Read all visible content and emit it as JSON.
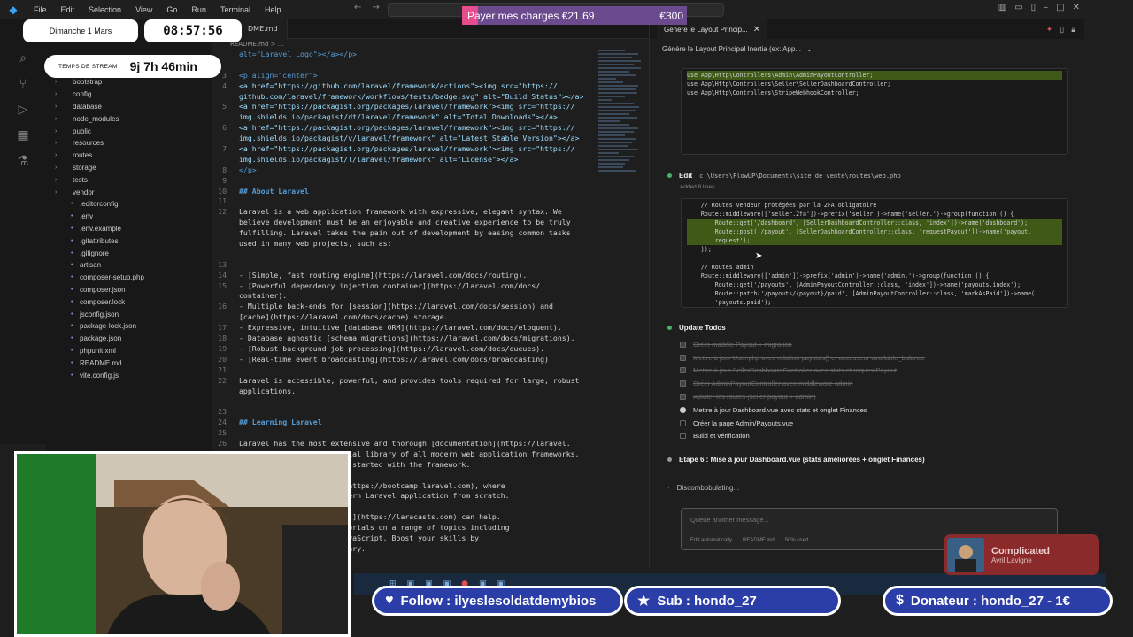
{
  "titlebar": {
    "menus": [
      "File",
      "Edit",
      "Selection",
      "View",
      "Go",
      "Run",
      "Terminal",
      "Help"
    ]
  },
  "sidebar": {
    "items": [
      {
        "name": "bootstrap",
        "type": "folder"
      },
      {
        "name": "config",
        "type": "folder"
      },
      {
        "name": "database",
        "type": "folder"
      },
      {
        "name": "node_modules",
        "type": "folder"
      },
      {
        "name": "public",
        "type": "folder"
      },
      {
        "name": "resources",
        "type": "folder"
      },
      {
        "name": "routes",
        "type": "folder"
      },
      {
        "name": "storage",
        "type": "folder"
      },
      {
        "name": "tests",
        "type": "folder"
      },
      {
        "name": "vendor",
        "type": "folder"
      },
      {
        "name": ".editorconfig",
        "type": "file"
      },
      {
        "name": ".env",
        "type": "file"
      },
      {
        "name": ".env.example",
        "type": "file"
      },
      {
        "name": ".gitattributes",
        "type": "file"
      },
      {
        "name": ".gitignore",
        "type": "file"
      },
      {
        "name": "artisan",
        "type": "file"
      },
      {
        "name": "composer-setup.php",
        "type": "file"
      },
      {
        "name": "composer.json",
        "type": "file"
      },
      {
        "name": "composer.lock",
        "type": "file"
      },
      {
        "name": "jsconfig.json",
        "type": "file"
      },
      {
        "name": "package-lock.json",
        "type": "file"
      },
      {
        "name": "package.json",
        "type": "file"
      },
      {
        "name": "phpunit.xml",
        "type": "file"
      },
      {
        "name": "README.md",
        "type": "file"
      },
      {
        "name": "vite.config.js",
        "type": "file"
      }
    ]
  },
  "editor": {
    "tab": "DME.md",
    "breadcrumb": "README.md > ...",
    "lines": [
      {
        "n": "",
        "t": "alt=\"Laravel Logo\"></a></p>",
        "c": "tag"
      },
      {
        "n": "",
        "t": "",
        "c": ""
      },
      {
        "n": "3",
        "t": "<p align=\"center\">",
        "c": "tag"
      },
      {
        "n": "4",
        "t": "<a href=\"https://github.com/laravel/framework/actions\"><img src=\"https://",
        "c": "link"
      },
      {
        "n": "",
        "t": "github.com/laravel/framework/workflows/tests/badge.svg\" alt=\"Build Status\"></a>",
        "c": "link"
      },
      {
        "n": "5",
        "t": "<a href=\"https://packagist.org/packages/laravel/framework\"><img src=\"https://",
        "c": "link"
      },
      {
        "n": "",
        "t": "img.shields.io/packagist/dt/laravel/framework\" alt=\"Total Downloads\"></a>",
        "c": "link"
      },
      {
        "n": "6",
        "t": "<a href=\"https://packagist.org/packages/laravel/framework\"><img src=\"https://",
        "c": "link"
      },
      {
        "n": "",
        "t": "img.shields.io/packagist/v/laravel/framework\" alt=\"Latest Stable Version\"></a>",
        "c": "link"
      },
      {
        "n": "7",
        "t": "<a href=\"https://packagist.org/packages/laravel/framework\"><img src=\"https://",
        "c": "link"
      },
      {
        "n": "",
        "t": "img.shields.io/packagist/l/laravel/framework\" alt=\"License\"></a>",
        "c": "link"
      },
      {
        "n": "8",
        "t": "</p>",
        "c": "tag"
      },
      {
        "n": "9",
        "t": "",
        "c": ""
      },
      {
        "n": "10",
        "t": "## About Laravel",
        "c": "head"
      },
      {
        "n": "11",
        "t": "",
        "c": ""
      },
      {
        "n": "12",
        "t": "Laravel is a web application framework with expressive, elegant syntax. We",
        "c": ""
      },
      {
        "n": "",
        "t": "believe development must be an enjoyable and creative experience to be truly",
        "c": ""
      },
      {
        "n": "",
        "t": "fulfilling. Laravel takes the pain out of development by easing common tasks",
        "c": ""
      },
      {
        "n": "",
        "t": "used in many web projects, such as:",
        "c": ""
      },
      {
        "n": "",
        "t": "",
        "c": ""
      },
      {
        "n": "13",
        "t": "",
        "c": ""
      },
      {
        "n": "14",
        "t": "- [Simple, fast routing engine](https://laravel.com/docs/routing).",
        "c": ""
      },
      {
        "n": "15",
        "t": "- [Powerful dependency injection container](https://laravel.com/docs/",
        "c": ""
      },
      {
        "n": "",
        "t": "container).",
        "c": ""
      },
      {
        "n": "16",
        "t": "- Multiple back-ends for [session](https://laravel.com/docs/session) and",
        "c": ""
      },
      {
        "n": "",
        "t": "[cache](https://laravel.com/docs/cache) storage.",
        "c": ""
      },
      {
        "n": "17",
        "t": "- Expressive, intuitive [database ORM](https://laravel.com/docs/eloquent).",
        "c": ""
      },
      {
        "n": "18",
        "t": "- Database agnostic [schema migrations](https://laravel.com/docs/migrations).",
        "c": ""
      },
      {
        "n": "19",
        "t": "- [Robust background job processing](https://laravel.com/docs/queues).",
        "c": ""
      },
      {
        "n": "20",
        "t": "- [Real-time event broadcasting](https://laravel.com/docs/broadcasting).",
        "c": ""
      },
      {
        "n": "21",
        "t": "",
        "c": ""
      },
      {
        "n": "22",
        "t": "Laravel is accessible, powerful, and provides tools required for large, robust",
        "c": ""
      },
      {
        "n": "",
        "t": "applications.",
        "c": ""
      },
      {
        "n": "",
        "t": "",
        "c": ""
      },
      {
        "n": "23",
        "t": "",
        "c": ""
      },
      {
        "n": "24",
        "t": "## Learning Laravel",
        "c": "head"
      },
      {
        "n": "25",
        "t": "",
        "c": ""
      },
      {
        "n": "26",
        "t": "Laravel has the most extensive and thorough [documentation](https://laravel.",
        "c": ""
      },
      {
        "n": "",
        "t": "com/docs) and video tutorial library of all modern web application frameworks,",
        "c": ""
      },
      {
        "n": "",
        "t": "making it a breeze to get started with the framework.",
        "c": ""
      },
      {
        "n": "",
        "t": "",
        "c": ""
      },
      {
        "n": "",
        "t": "        aravel Bootcamp](https://bootcamp.laravel.com), where",
        "c": ""
      },
      {
        "n": "",
        "t": "        gh building a modern Laravel application from scratch.",
        "c": ""
      },
      {
        "n": "",
        "t": "",
        "c": ""
      },
      {
        "n": "",
        "t": "        eading, [Laracasts](https://laracasts.com) can help.",
        "c": ""
      },
      {
        "n": "",
        "t": "        ands of video tutorials on a range of topics including",
        "c": ""
      },
      {
        "n": "",
        "t": "        t testing, and JavaScript. Boost your skills by",
        "c": ""
      },
      {
        "n": "",
        "t": "        ensive video library.",
        "c": ""
      }
    ]
  },
  "chat": {
    "tab_title": "Génère le Layout Princip...",
    "session_title": "Génère le Layout Principal Inertia (ex: App...",
    "imports_code": [
      "use App\\Http\\Controllers\\Admin\\AdminPayoutController;",
      "use App\\Http\\Controllers\\Seller\\SellerDashboardController;",
      "use App\\Http\\Controllers\\StripeWebhookController;"
    ],
    "edit_step": {
      "label": "Edit",
      "path": "c:\\Users\\FlowUP\\Documents\\site de vente\\routes\\web.php",
      "note": "Added 8 lines"
    },
    "routes_code": [
      "    // Routes vendeur protégées par la 2FA obligatoire",
      "    Route::middleware(['seller.2fa'])->prefix('seller')->name('seller.')->group(function () {",
      "        Route::get('/dashboard', [SellerDashboardController::class, 'index'])->name('dashboard');",
      "        Route::post('/payout', [SellerDashboardController::class, 'requestPayout'])->name('payout.",
      "        request');",
      "    });",
      "",
      "    // Routes admin",
      "    Route::middleware(['admin'])->prefix('admin')->name('admin.')->group(function () {",
      "        Route::get('/payouts', [AdminPayoutController::class, 'index'])->name('payouts.index');",
      "        Route::patch('/payouts/{payout}/paid', [AdminPayoutController::class, 'markAsPaid'])->name(",
      "        'payouts.paid');"
    ],
    "todos_label": "Update Todos",
    "todos": [
      {
        "text": "Créer modèle Payout + migration",
        "state": "done"
      },
      {
        "text": "Mettre à jour User.php avec relation payouts() et accesseur available_balance",
        "state": "done"
      },
      {
        "text": "Mettre à jour SellerDashboardController avec stats et requestPayout",
        "state": "done"
      },
      {
        "text": "Créer AdminPayoutController avec middleware admin",
        "state": "done"
      },
      {
        "text": "Ajouter les routes (seller payout + admin)",
        "state": "done"
      },
      {
        "text": "Mettre à jour Dashboard.vue avec stats et onglet Finances",
        "state": "inprog"
      },
      {
        "text": "Créer la page Admin/Payouts.vue",
        "state": "todo"
      },
      {
        "text": "Build et vérification",
        "state": "todo"
      }
    ],
    "step6": "Etape 6 : Mise à jour Dashboard.vue (stats améliorées + onglet Finances)",
    "status": "Discombobulating...",
    "input_placeholder": "Queue another message...",
    "input_meta": [
      "Edit automatically",
      "README.md",
      "50% used"
    ]
  },
  "overlays": {
    "date": "Dimanche 1 Mars",
    "clock": "08:57:56",
    "stream_label": "TEMPS DE STREAM",
    "stream_time": "9j 7h 46min",
    "goal_text": "Payer mes charges €21.69",
    "goal_target": "€300",
    "goal_progress": 0.0723,
    "follow": "Follow : ilyeslesoldatdemybios",
    "sub": "Sub : hondo_27",
    "donor": "Donateur : hondo_27 - 1€",
    "song": "Complicated",
    "artist": "Avril Lavigne"
  },
  "colors": {
    "accent_green": "#3f5a17",
    "goal_fill": "#e64d8c",
    "banner_blue": "#2b3ea8"
  }
}
